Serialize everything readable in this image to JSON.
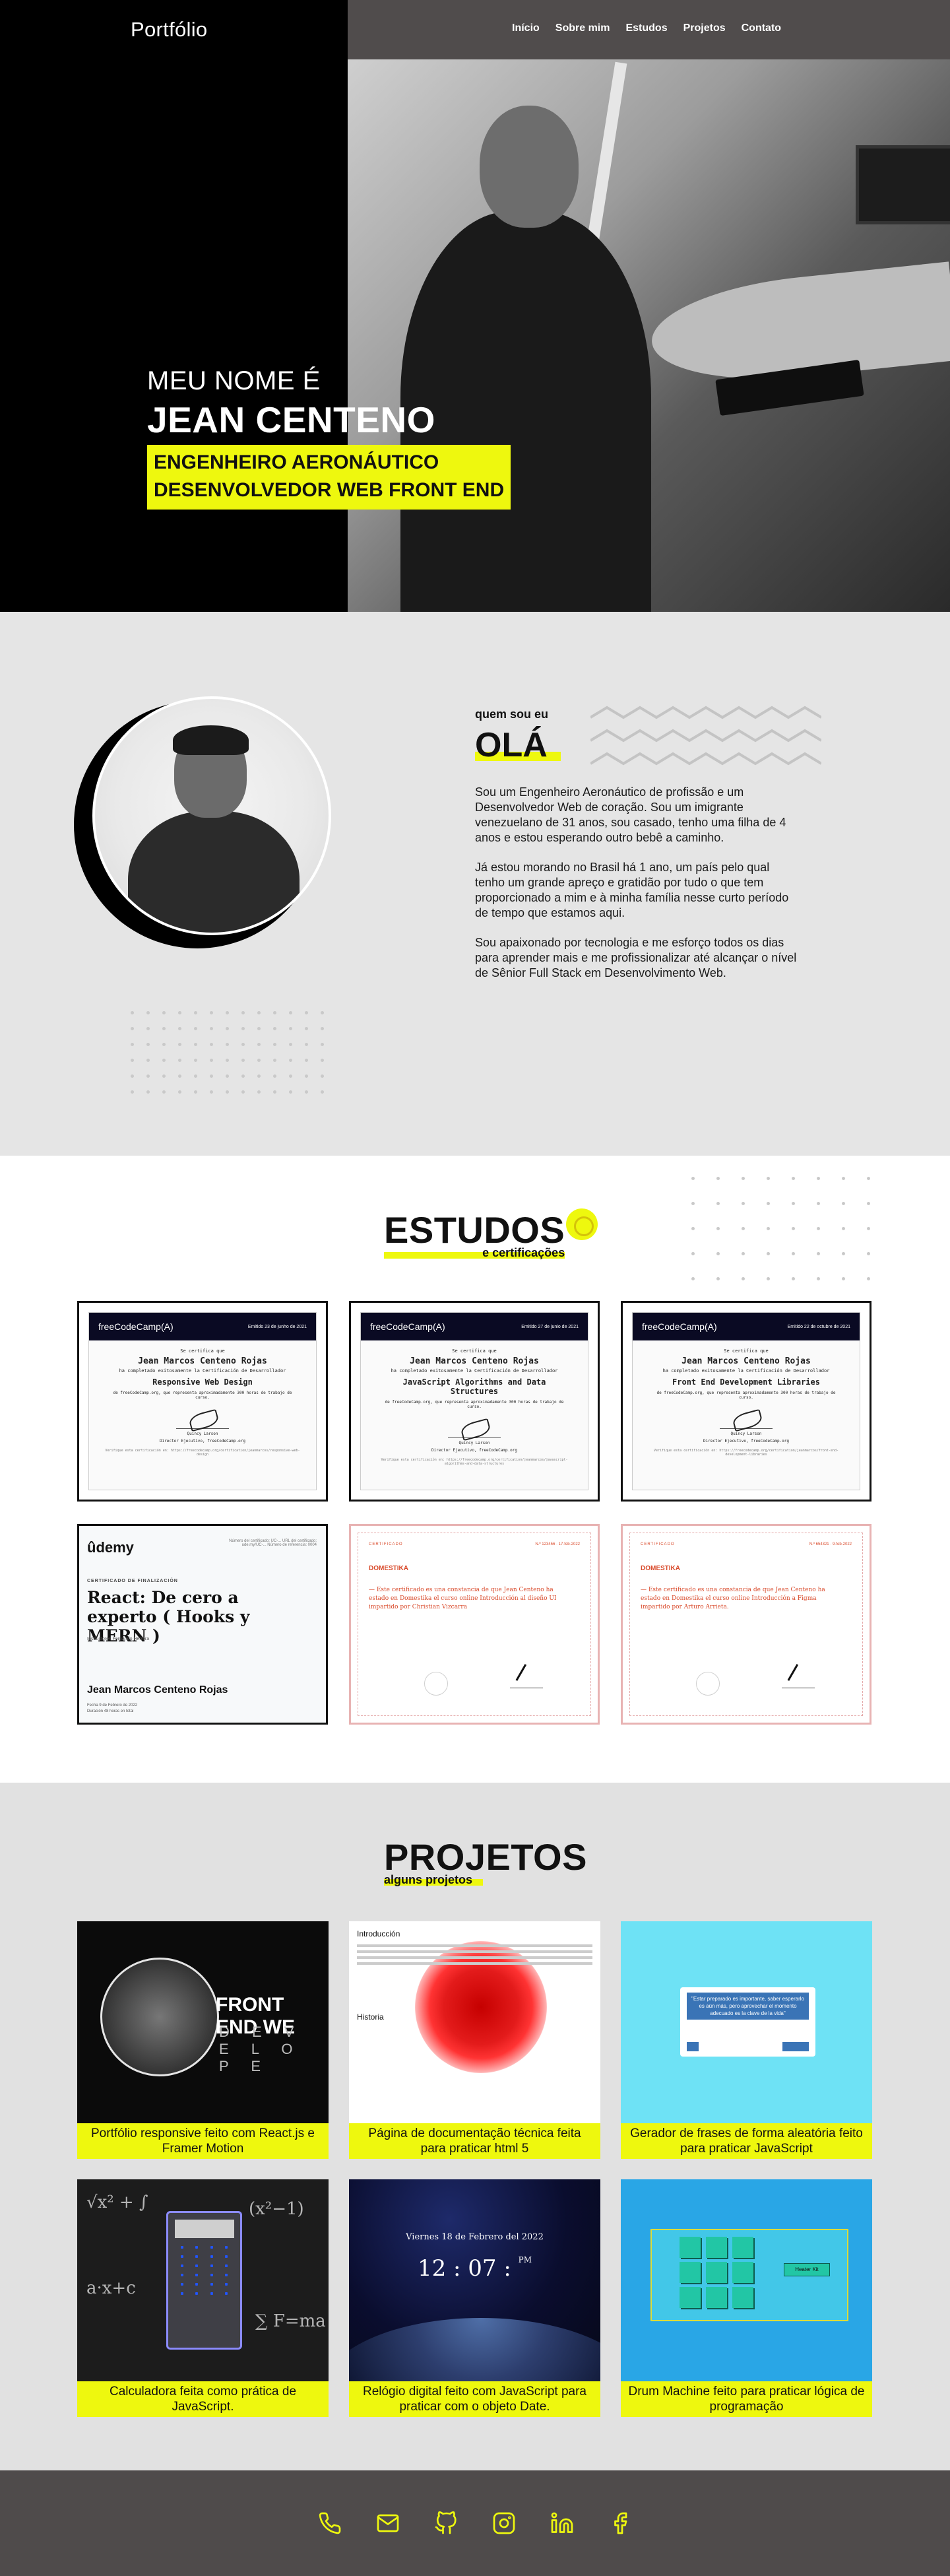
{
  "header": {
    "brand": "Portfólio",
    "nav": [
      "Início",
      "Sobre mim",
      "Estudos",
      "Projetos",
      "Contato"
    ]
  },
  "hero": {
    "subtitle": "MEU NOME É",
    "name": "JEAN CENTENO",
    "roles": [
      "ENGENHEIRO AERONÁUTICO",
      "DESENVOLVEDOR WEB FRONT END"
    ]
  },
  "about": {
    "kicker": "quem sou eu",
    "greeting": "OLÁ",
    "paragraphs": [
      "Sou um Engenheiro Aeronáutico de profissão e um Desenvolvedor Web de coração. Sou um imigrante venezuelano de 31 anos, sou casado, tenho uma filha de 4 anos e estou esperando outro bebê a caminho.",
      "Já estou morando no Brasil há 1 ano, um país pelo qual tenho um grande apreço e gratidão por tudo o que tem proporcionado a mim e à minha família nesse curto período de tempo que estamos aqui.",
      "Sou apaixonado por tecnologia e me esforço todos os dias para aprender mais e me profissionalizar até alcançar o nível de Sênior Full Stack em Desenvolvimento Web."
    ]
  },
  "studies": {
    "title": "ESTUDOS",
    "subtitle": "e certificações",
    "fcc": [
      {
        "logo": "freeCodeCamp(A)",
        "date": "Emitido 23 de junho de 2021",
        "certify": "Se certifica que",
        "name": "Jean Marcos Centeno Rojas",
        "completed": "ha completado exitosamente la Certificación de Desarrollador",
        "course": "Responsive Web Design",
        "hours": "de freeCodeCamp.org, que representa aproximadamente 300 horas de trabajo de curso.",
        "signer": "Quincy Larson",
        "signer_role": "Director Ejecutivo, freeCodeCamp.org",
        "verify": "Verifique esta certificación en: https://freecodecamp.org/certification/jeanmarcos/responsive-web-design"
      },
      {
        "logo": "freeCodeCamp(A)",
        "date": "Emitido 27 de junio de 2021",
        "certify": "Se certifica que",
        "name": "Jean Marcos Centeno Rojas",
        "completed": "ha completado exitosamente la Certificación de Desarrollador",
        "course": "JavaScript Algorithms and Data Structures",
        "hours": "de freeCodeCamp.org, que representa aproximadamente 300 horas de trabajo de curso.",
        "signer": "Quincy Larson",
        "signer_role": "Director Ejecutivo, freeCodeCamp.org",
        "verify": "Verifique esta certificación en: https://freecodecamp.org/certification/jeanmarcos/javascript-algorithms-and-data-structures"
      },
      {
        "logo": "freeCodeCamp(A)",
        "date": "Emitido 22 de octubre de 2021",
        "certify": "Se certifica que",
        "name": "Jean Marcos Centeno Rojas",
        "completed": "ha completado exitosamente la Certificación de Desarrollador",
        "course": "Front End Development Libraries",
        "hours": "de freeCodeCamp.org, que representa aproximadamente 300 horas de trabajo de curso.",
        "signer": "Quincy Larson",
        "signer_role": "Director Ejecutivo, freeCodeCamp.org",
        "verify": "Verifique esta certificación en: https://freecodecamp.org/certification/jeanmarcos/front-end-development-libraries"
      }
    ],
    "udemy": {
      "logo": "ûdemy",
      "ref": "Número del certificado: UC-... URL del certificado: ude.my/UC-... Número de referencia: 0004",
      "label": "CERTIFICADO DE FINALIZACIÓN",
      "course": "React: De cero a experto ( Hooks y MERN )",
      "instructor": "Instructores  Fernando Herrera",
      "name": "Jean Marcos Centeno Rojas",
      "date": "Fecha  9 de Febrero de 2022",
      "duration": "Duración  48 horas en total"
    },
    "domestika": [
      {
        "head": "CERTIFICADO",
        "top": "N.º 123456 · 17-feb-2022",
        "brand": "DOMESTIKA",
        "text": "— Este certificado es una constancia de que Jean Centeno ha estado en Domestika el curso online Introducción al diseño UI impartido por Christian Vizcarra"
      },
      {
        "head": "CERTIFICADO",
        "top": "N.º 654321 · 9-feb-2022",
        "brand": "DOMESTIKA",
        "text": "— Este certificado es una constancia de que Jean Centeno ha estado en Domestika el curso online Introducción a Figma impartido por Arturo Arrieta."
      }
    ]
  },
  "projects": {
    "title": "PROJETOS",
    "subtitle": "alguns projetos",
    "items": [
      {
        "caption": "Portfólio responsive feito com React.js e Framer Motion",
        "thumb_text": "FRONT END WE",
        "thumb_sub": "D E V E L O P E"
      },
      {
        "caption": "Página de documentação técnica feita para praticar html 5",
        "thumb_text": "Introducción",
        "thumb_sub": "Historia"
      },
      {
        "caption": "Gerador de frases de forma aleatória feito para praticar JavaScript",
        "thumb_text": "\"Estar preparado es importante, saber esperarlo es aún más, pero aprovechar el momento adecuado es la clave de la vida\""
      },
      {
        "caption": "Calculadora feita como prática de JavaScript.",
        "thumb_text": ""
      },
      {
        "caption": "Relógio digital feito com JavaScript para praticar com o objeto Date.",
        "thumb_text": "Viernes 18 de Febrero del 2022",
        "thumb_sub": "12 : 07 :",
        "thumb_ampm": "PM"
      },
      {
        "caption": "Drum Machine feito para praticar lógica de programação",
        "thumb_text": "Heater Kit"
      }
    ]
  },
  "footer": {
    "icons": [
      "phone-icon",
      "mail-icon",
      "github-icon",
      "instagram-icon",
      "linkedin-icon",
      "facebook-icon"
    ]
  },
  "colors": {
    "accent": "#eef80e",
    "dark": "#504c4c",
    "light": "#e5e5e5"
  }
}
